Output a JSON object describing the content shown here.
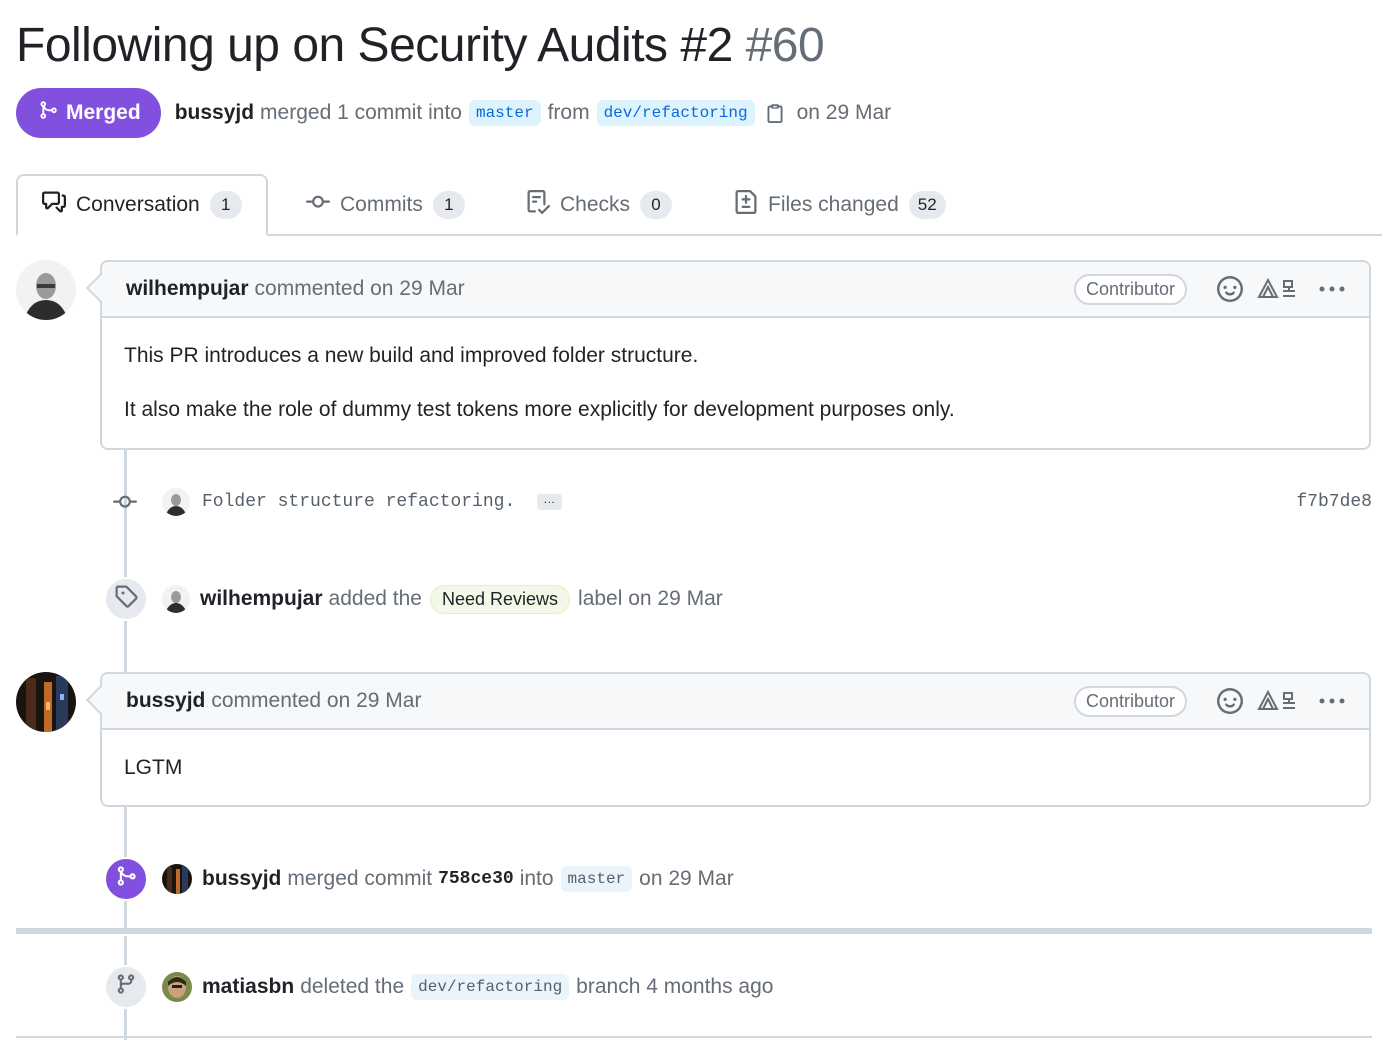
{
  "pr": {
    "title": "Following up on Security Audits #2",
    "number": "#60",
    "state_label": "Merged",
    "author": "bussyjd",
    "merge_text": "merged 1 commit into",
    "base_branch": "master",
    "from_text": "from",
    "head_branch": "dev/refactoring",
    "date_text": "on 29 Mar"
  },
  "tabs": [
    {
      "label": "Conversation",
      "count": "1",
      "icon": "comment-discussion-icon",
      "active": true
    },
    {
      "label": "Commits",
      "count": "1",
      "icon": "git-commit-icon",
      "active": false
    },
    {
      "label": "Checks",
      "count": "0",
      "icon": "checklist-icon",
      "active": false
    },
    {
      "label": "Files changed",
      "count": "52",
      "icon": "file-diff-icon",
      "active": false
    }
  ],
  "comments": [
    {
      "author": "wilhempujar",
      "action": "commented on 29 Mar",
      "role": "Contributor",
      "body": [
        "This PR introduces a new build and improved folder structure.",
        "It also make the role of dummy test tokens more explicitly for development purposes only."
      ]
    },
    {
      "author": "bussyjd",
      "action": "commented on 29 Mar",
      "role": "Contributor",
      "body": [
        "LGTM"
      ]
    }
  ],
  "commit": {
    "message": "Folder structure refactoring.",
    "ellipsis": "…",
    "sha": "f7b7de8"
  },
  "label_event": {
    "author": "wilhempujar",
    "pre": "added the",
    "label": "Need Reviews",
    "post": "label on 29 Mar"
  },
  "merge_event": {
    "author": "bussyjd",
    "pre": "merged commit",
    "sha": "758ce30",
    "mid": "into",
    "branch": "master",
    "post": "on 29 Mar"
  },
  "delete_event": {
    "author": "matiasbn",
    "pre": "deleted the",
    "branch": "dev/refactoring",
    "post": "branch 4 months ago"
  },
  "colors": {
    "merged_purple": "#8250df",
    "branch_blue_bg": "#ddf4ff",
    "branch_blue_text": "#0969da",
    "label_bg": "#f3f9e6",
    "border": "#d0d7de",
    "muted_text": "#656d76"
  }
}
